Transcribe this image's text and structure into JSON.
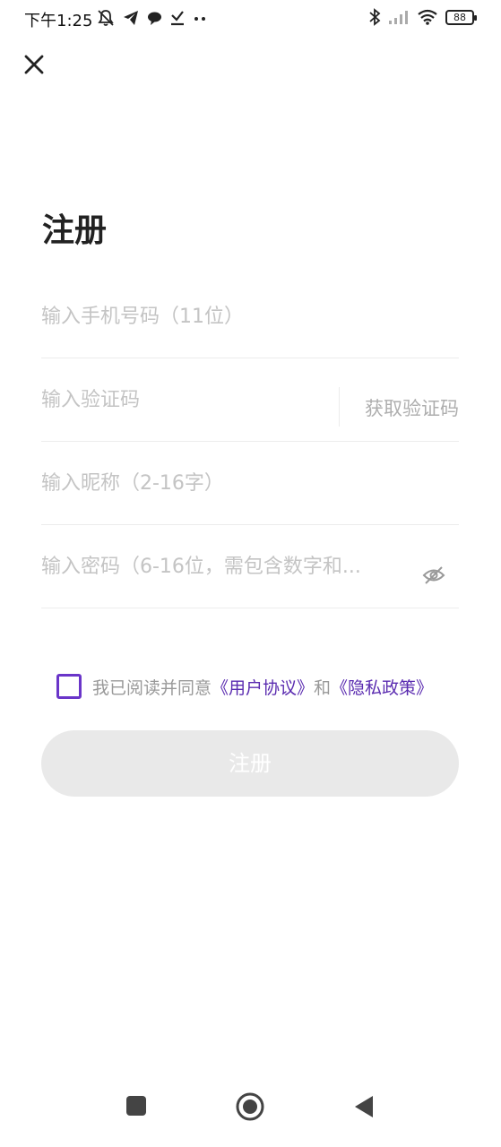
{
  "status_bar": {
    "time": "下午1:25",
    "left_icons": [
      "mute-icon",
      "telegram-icon",
      "message-icon",
      "download-icon",
      "more-dots-icon"
    ],
    "right_icons": [
      "bluetooth-icon",
      "signal-icon",
      "wifi-icon",
      "battery-icon"
    ],
    "battery_level": "88"
  },
  "page": {
    "title": "注册"
  },
  "form": {
    "phone_placeholder": "输入手机号码（11位）",
    "code_placeholder": "输入验证码",
    "get_code_label": "获取验证码",
    "nickname_placeholder": "输入昵称（2-16字）",
    "password_placeholder": "输入密码（6-16位，需包含数字和..."
  },
  "agreement": {
    "prefix": "我已阅读并同意",
    "user_agreement": "《用户协议》",
    "and": "和",
    "privacy_policy": "《隐私政策》",
    "checked": false
  },
  "register_button_label": "注册",
  "colors": {
    "accent": "#6a35c9",
    "link": "#5a2bb0",
    "placeholder": "#c4c4c4",
    "button_disabled": "#e9e9e9"
  },
  "nav_bar": {
    "buttons": [
      "recent-apps-icon",
      "home-icon",
      "back-icon"
    ]
  }
}
